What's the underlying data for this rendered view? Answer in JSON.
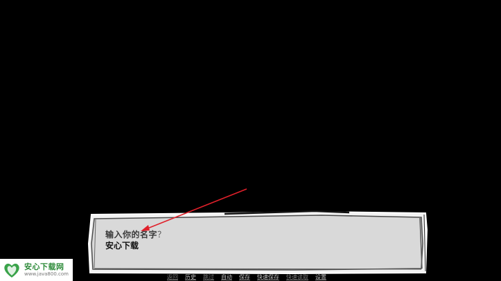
{
  "dialogue": {
    "prompt": "输入你的名字",
    "prompt_suffix": "？",
    "input_value": "安心下载",
    "input_placeholder": ""
  },
  "quick_menu": [
    {
      "label": "返回",
      "dim": true
    },
    {
      "label": "历史",
      "dim": false
    },
    {
      "label": "跳过",
      "dim": true
    },
    {
      "label": "自动",
      "dim": false
    },
    {
      "label": "保存",
      "dim": false
    },
    {
      "label": "快速保存",
      "dim": false
    },
    {
      "label": "快速读取",
      "dim": true
    },
    {
      "label": "设置",
      "dim": false
    }
  ],
  "watermark": {
    "logo_text": "安心下载",
    "title": "安心下载网",
    "url": "www.java800.com"
  },
  "colors": {
    "background": "#000000",
    "box_fill": "#d9d9d9",
    "box_border": "#f2f2f2",
    "arrow": "#e0202a",
    "watermark_green": "#2e8b3a"
  },
  "icons": {
    "annotation_arrow": "red-arrow-icon",
    "watermark_logo": "heart-leaf-logo-icon"
  }
}
